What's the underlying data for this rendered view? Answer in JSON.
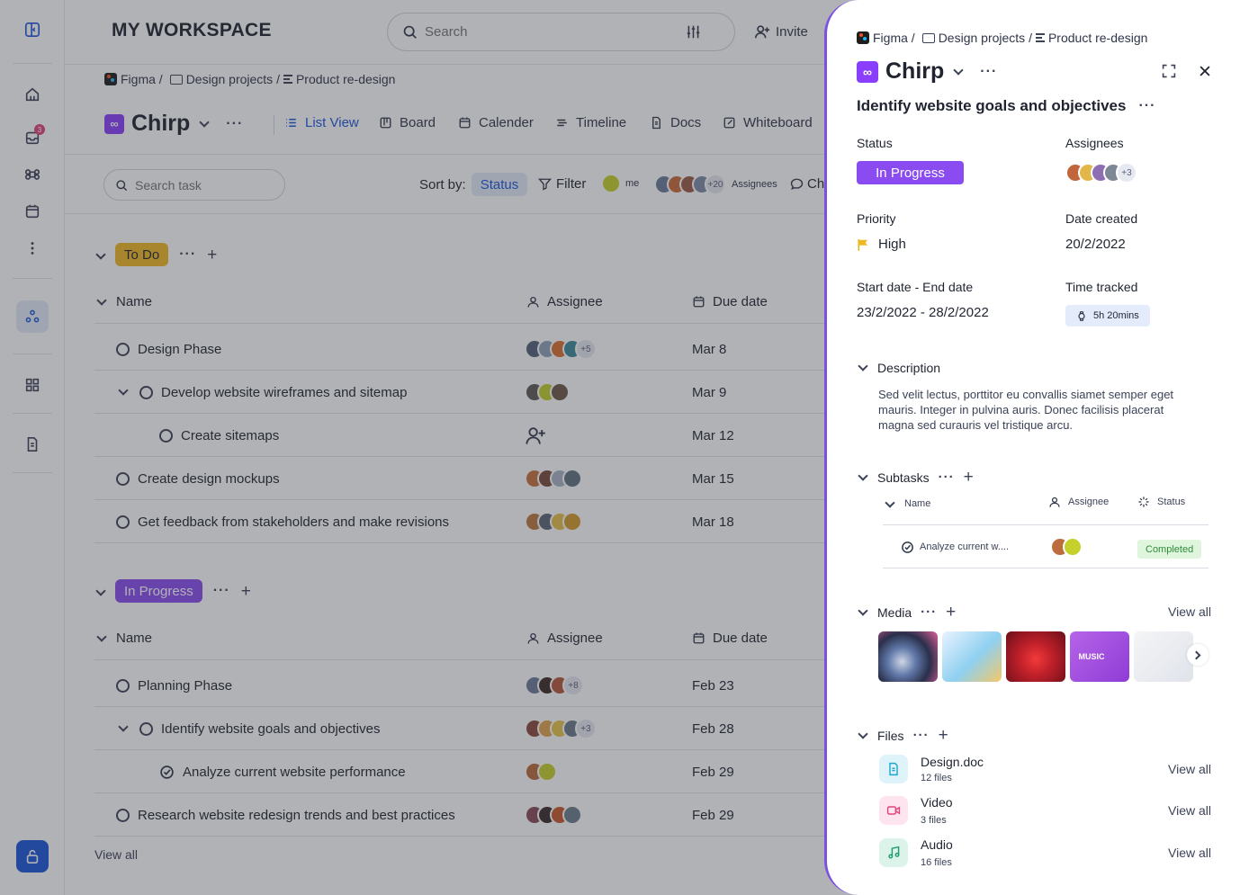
{
  "workspace": {
    "title": "MY WORKSPACE"
  },
  "search": {
    "placeholder": "Search"
  },
  "invite_label": "Invite",
  "rail": {
    "inbox_badge": "3"
  },
  "breadcrumb": {
    "items": [
      "Figma /",
      "Design projects /",
      "Product re-design"
    ]
  },
  "project": {
    "name": "Chirp"
  },
  "views": [
    "List View",
    "Board",
    "Calender",
    "Timeline",
    "Docs",
    "Whiteboard"
  ],
  "toolbar": {
    "search_placeholder": "Search task",
    "sort_label": "Sort by:",
    "sort_value": "Status",
    "filter_label": "Filter",
    "me_label": "me",
    "assignees_count": "+20",
    "assignees_label": "Assignees",
    "chat_label": "Ch"
  },
  "columns": {
    "name": "Name",
    "assignee": "Assignee",
    "due": "Due date"
  },
  "groups": [
    {
      "status": "To Do",
      "color": "#f1b826",
      "tasks": [
        {
          "name": "Design Phase",
          "due": "Mar 8",
          "more": "+5",
          "level": 0
        },
        {
          "name": "Develop website wireframes and sitemap",
          "due": "Mar 9",
          "more": "",
          "level": 1
        },
        {
          "name": "Create sitemaps",
          "due": "Mar 12",
          "more": "",
          "level": 2
        },
        {
          "name": "Create design mockups",
          "due": "Mar 15",
          "more": "",
          "level": 0
        },
        {
          "name": "Get feedback from stakeholders and make revisions",
          "due": "Mar 18",
          "more": "",
          "level": 0
        }
      ]
    },
    {
      "status": "In Progress",
      "color": "#8a4cf0",
      "tasks": [
        {
          "name": "Planning Phase",
          "due": "Feb 23",
          "more": "+8",
          "level": 0
        },
        {
          "name": "Identify website goals and objectives",
          "due": "Feb 28",
          "more": "+3",
          "level": 1
        },
        {
          "name": "Analyze current website performance",
          "due": "Feb 29",
          "more": "",
          "level": 2
        },
        {
          "name": "Research website redesign trends and best practices",
          "due": "Feb 29",
          "more": "",
          "level": 0
        }
      ]
    }
  ],
  "view_all": "View all",
  "panel": {
    "breadcrumb": [
      "Figma /",
      "Design projects /",
      "Product re-design"
    ],
    "project": "Chirp",
    "task_title": "Identify website goals and objectives",
    "status_label": "Status",
    "status_value": "In Progress",
    "assignees_label": "Assignees",
    "assignees_more": "+3",
    "priority_label": "Priority",
    "priority_value": "High",
    "date_created_label": "Date created",
    "date_created_value": "20/2/2022",
    "dates_label": "Start date - End date",
    "dates_value": "23/2/2022 - 28/2/2022",
    "time_label": "Time tracked",
    "time_value": "5h 20mins",
    "description_label": "Description",
    "description_text": "Sed velit lectus, porttitor eu convallis siamet semper eget mauris. Integer in pulvina auris. Donec facilisis placerat magna sed curauris vel tristique arcu.",
    "subtasks_label": "Subtasks",
    "subtask_columns": {
      "name": "Name",
      "assignee": "Assignee",
      "status": "Status"
    },
    "subtask": {
      "name": "Analyze current w....",
      "status": "Completed"
    },
    "media_label": "Media",
    "media_view_all": "View all",
    "media_poster_text": "MUSIC",
    "files_label": "Files",
    "files": [
      {
        "name": "Design.doc",
        "count": "12 files",
        "view": "View all"
      },
      {
        "name": "Video",
        "count": "3 files",
        "view": "View all"
      },
      {
        "name": "Audio",
        "count": "16 files",
        "view": "View all"
      }
    ]
  },
  "colors": {
    "accent": "#8a4cf0",
    "todo": "#f1b826",
    "panel_border": "#7b52e0",
    "completed_bg": "#dff6dd"
  }
}
